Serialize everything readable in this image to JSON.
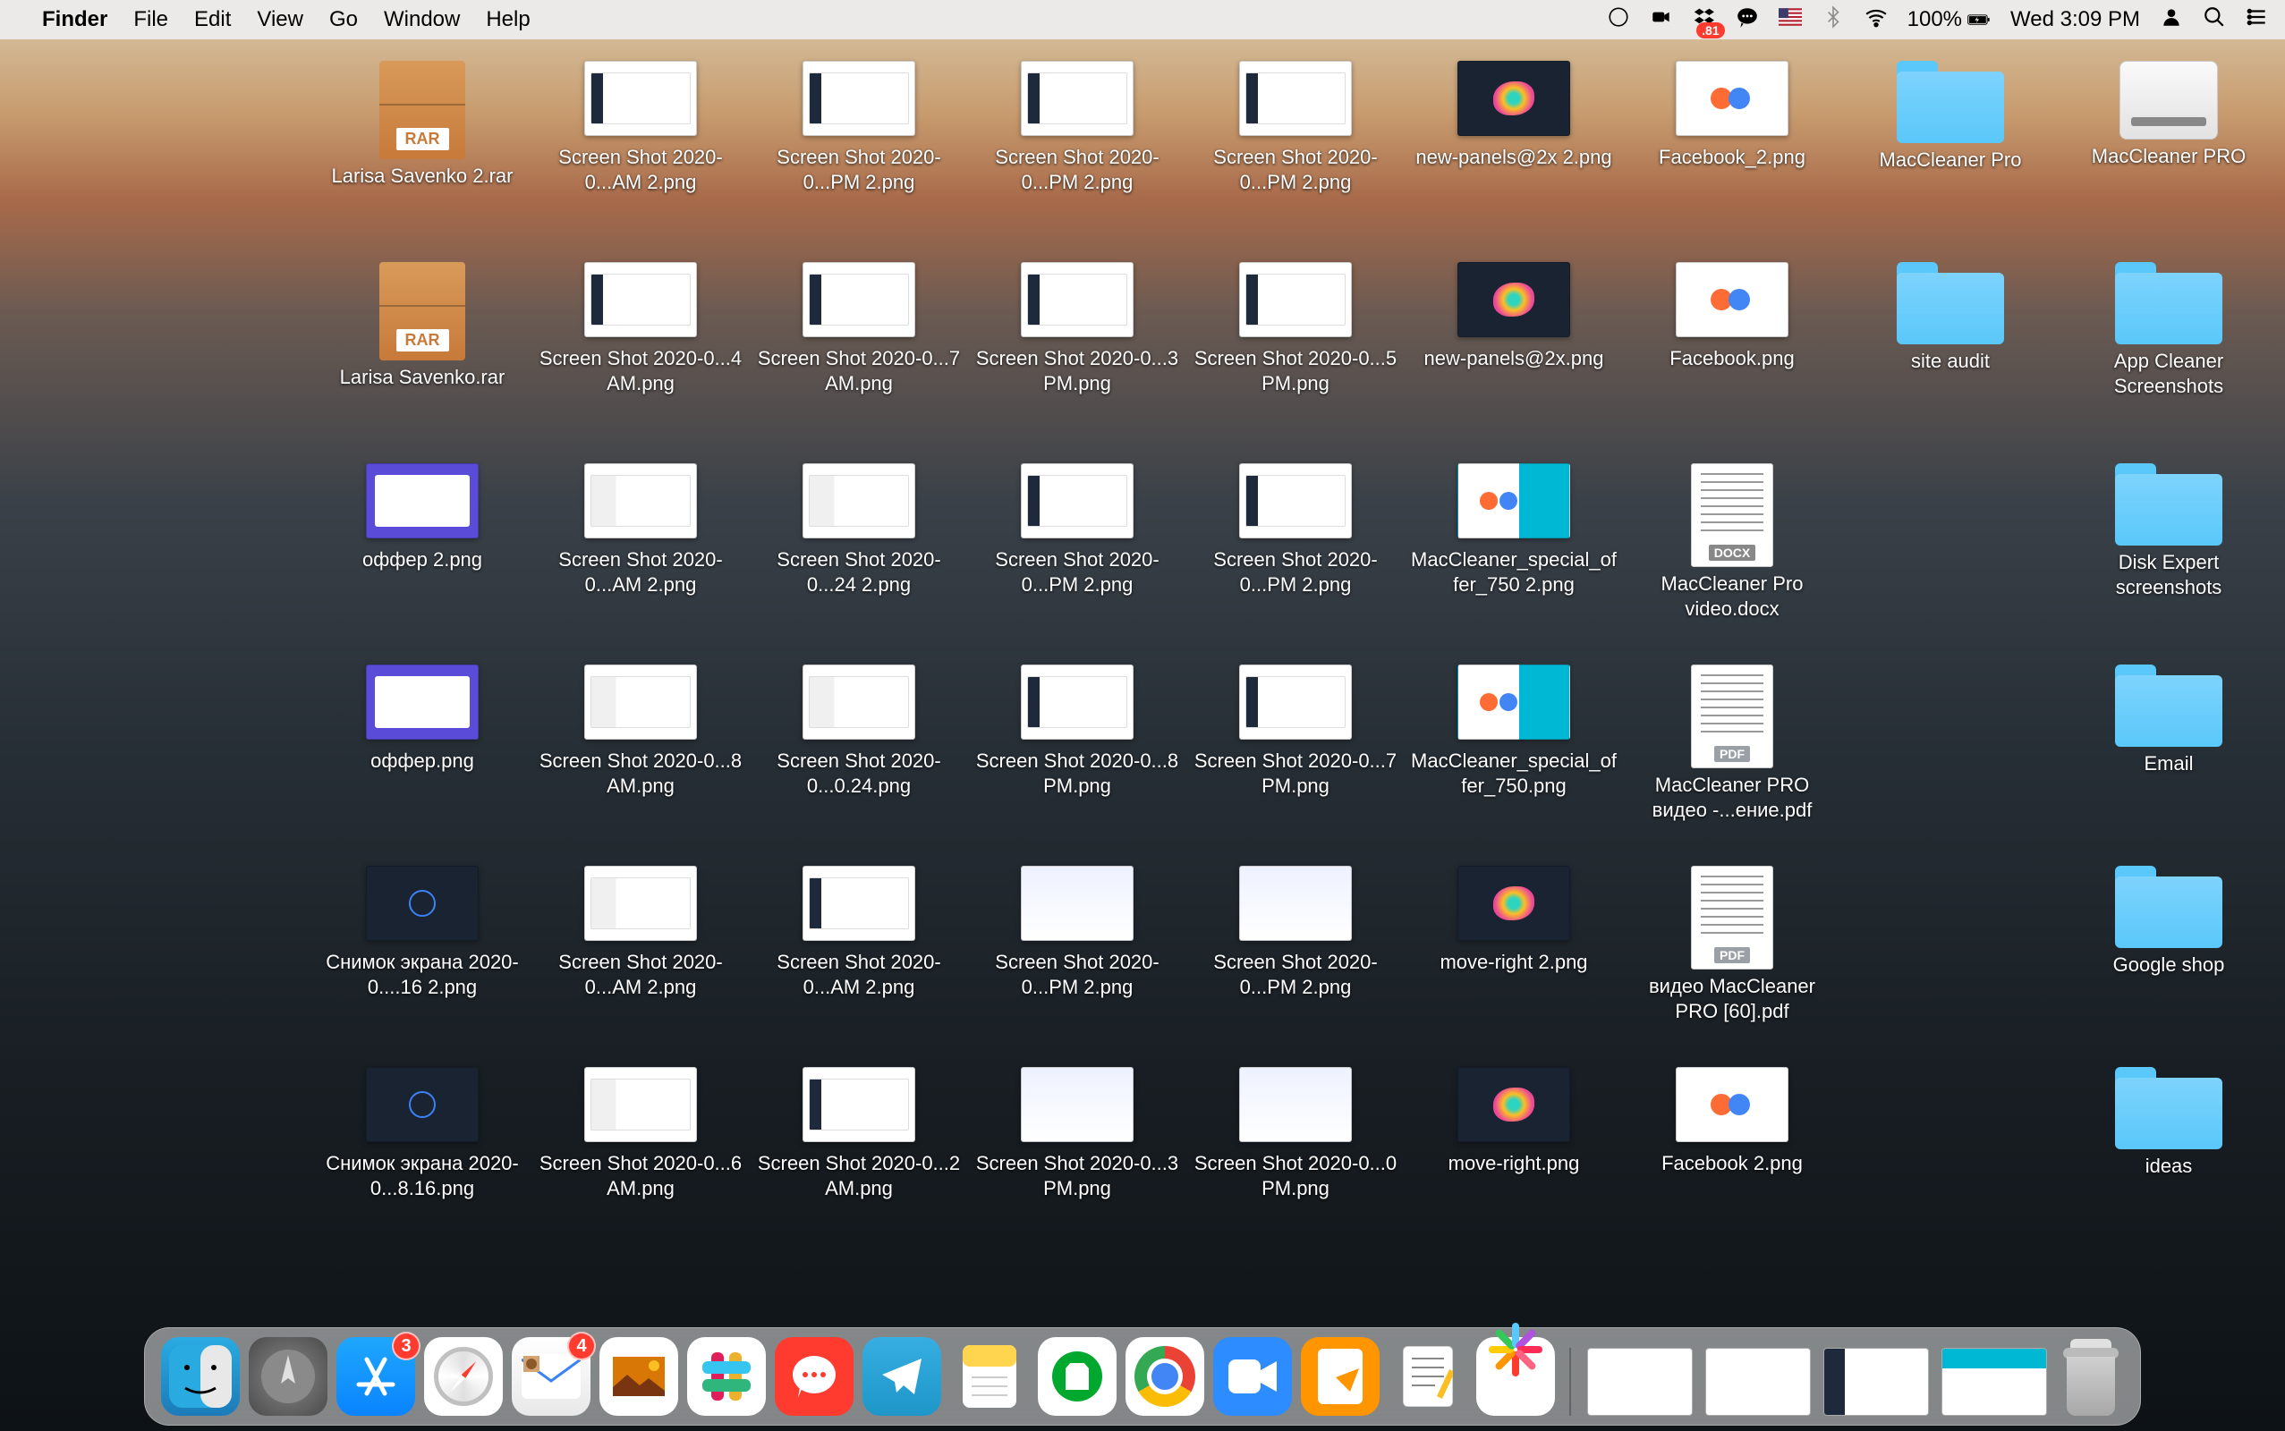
{
  "menubar": {
    "app": "Finder",
    "items": [
      "File",
      "Edit",
      "View",
      "Go",
      "Window",
      "Help"
    ],
    "dropbox_badge": ".81",
    "battery": "100%",
    "clock": "Wed 3:09 PM"
  },
  "desktop": {
    "rows": [
      [
        {
          "type": "rar",
          "label": "Larisa Savenko 2.rar"
        },
        {
          "type": "shot",
          "variant": "sb",
          "label": "Screen Shot 2020-0...AM 2.png"
        },
        {
          "type": "shot",
          "variant": "sb",
          "label": "Screen Shot 2020-0...PM 2.png"
        },
        {
          "type": "shot",
          "variant": "sb",
          "label": "Screen Shot 2020-0...PM 2.png"
        },
        {
          "type": "shot",
          "variant": "sb",
          "label": "Screen Shot 2020-0...PM 2.png"
        },
        {
          "type": "shot",
          "variant": "blob",
          "label": "new-panels@2x 2.png"
        },
        {
          "type": "shot",
          "variant": "fb",
          "label": "Facebook_2.png"
        },
        {
          "type": "folder",
          "label": "MacCleaner Pro"
        },
        {
          "type": "drive",
          "label": "MacCleaner PRO"
        }
      ],
      [
        {
          "type": "rar",
          "label": "Larisa Savenko.rar"
        },
        {
          "type": "shot",
          "variant": "sb",
          "label": "Screen Shot 2020-0...4 AM.png"
        },
        {
          "type": "shot",
          "variant": "sb",
          "label": "Screen Shot 2020-0...7 AM.png"
        },
        {
          "type": "shot",
          "variant": "sb",
          "label": "Screen Shot 2020-0...3 PM.png"
        },
        {
          "type": "shot",
          "variant": "sb",
          "label": "Screen Shot 2020-0...5 PM.png"
        },
        {
          "type": "shot",
          "variant": "blob",
          "label": "new-panels@2x.png"
        },
        {
          "type": "shot",
          "variant": "fb",
          "label": "Facebook.png"
        },
        {
          "type": "folder",
          "label": "site audit"
        },
        {
          "type": "folder",
          "label": "App Cleaner Screenshots"
        }
      ],
      [
        {
          "type": "shot",
          "variant": "purple",
          "label": "оффер 2.png"
        },
        {
          "type": "shot",
          "variant": "plain",
          "label": "Screen Shot 2020-0...AM 2.png"
        },
        {
          "type": "shot",
          "variant": "plain",
          "label": "Screen Shot 2020-0...24 2.png"
        },
        {
          "type": "shot",
          "variant": "sb",
          "label": "Screen Shot 2020-0...PM 2.png"
        },
        {
          "type": "shot",
          "variant": "sb",
          "label": "Screen Shot 2020-0...PM 2.png"
        },
        {
          "type": "shot",
          "variant": "mcl",
          "label": "MacCleaner_special_offer_750 2.png"
        },
        {
          "type": "doc",
          "docType": "DOCX",
          "label": "MacCleaner Pro video.docx"
        },
        {
          "type": "blank",
          "label": ""
        },
        {
          "type": "folder",
          "label": "Disk Expert screenshots"
        }
      ],
      [
        {
          "type": "shot",
          "variant": "purple",
          "label": "оффер.png"
        },
        {
          "type": "shot",
          "variant": "plain",
          "label": "Screen Shot 2020-0...8 AM.png"
        },
        {
          "type": "shot",
          "variant": "plain",
          "label": "Screen Shot 2020-0...0.24.png"
        },
        {
          "type": "shot",
          "variant": "sb",
          "label": "Screen Shot 2020-0...8 PM.png"
        },
        {
          "type": "shot",
          "variant": "sb",
          "label": "Screen Shot 2020-0...7 PM.png"
        },
        {
          "type": "shot",
          "variant": "mcl",
          "label": "MacCleaner_special_offer_750.png"
        },
        {
          "type": "doc",
          "docType": "PDF",
          "label": "MacCleaner PRO видео -...ение.pdf"
        },
        {
          "type": "blank",
          "label": ""
        },
        {
          "type": "folder",
          "label": "Email"
        }
      ],
      [
        {
          "type": "shot",
          "variant": "dark",
          "label": "Снимок экрана 2020-0....16 2.png"
        },
        {
          "type": "shot",
          "variant": "plain",
          "label": "Screen Shot 2020-0...AM 2.png"
        },
        {
          "type": "shot",
          "variant": "sb",
          "label": "Screen Shot 2020-0...AM 2.png"
        },
        {
          "type": "shot",
          "variant": "pale",
          "label": "Screen Shot 2020-0...PM 2.png"
        },
        {
          "type": "shot",
          "variant": "pale",
          "label": "Screen Shot 2020-0...PM 2.png"
        },
        {
          "type": "shot",
          "variant": "blob",
          "label": "move-right 2.png"
        },
        {
          "type": "doc",
          "docType": "PDF",
          "label": "видео MacCleaner PRO [60].pdf"
        },
        {
          "type": "blank",
          "label": ""
        },
        {
          "type": "folder",
          "label": "Google shop"
        }
      ],
      [
        {
          "type": "shot",
          "variant": "dark",
          "label": "Снимок экрана 2020-0...8.16.png"
        },
        {
          "type": "shot",
          "variant": "plain",
          "label": "Screen Shot 2020-0...6 AM.png"
        },
        {
          "type": "shot",
          "variant": "sb",
          "label": "Screen Shot 2020-0...2 AM.png"
        },
        {
          "type": "shot",
          "variant": "pale",
          "label": "Screen Shot 2020-0...3 PM.png"
        },
        {
          "type": "shot",
          "variant": "pale",
          "label": "Screen Shot 2020-0...0 PM.png"
        },
        {
          "type": "shot",
          "variant": "blob",
          "label": "move-right.png"
        },
        {
          "type": "shot",
          "variant": "fb",
          "label": "Facebook 2.png"
        },
        {
          "type": "blank",
          "label": ""
        },
        {
          "type": "folder",
          "label": "ideas"
        }
      ]
    ]
  },
  "dock": {
    "apps": [
      {
        "name": "finder",
        "cls": "di-finder",
        "badge": null
      },
      {
        "name": "launchpad",
        "cls": "di-launch",
        "badge": null
      },
      {
        "name": "app-store",
        "cls": "di-appstore",
        "badge": "3"
      },
      {
        "name": "safari",
        "cls": "di-safari",
        "badge": null
      },
      {
        "name": "mail",
        "cls": "di-mail",
        "badge": "4"
      },
      {
        "name": "photos",
        "cls": "di-photos",
        "badge": null
      },
      {
        "name": "slack",
        "cls": "di-slack",
        "badge": null
      },
      {
        "name": "messenger",
        "cls": "di-chat",
        "badge": null
      },
      {
        "name": "telegram",
        "cls": "di-tg",
        "badge": null
      },
      {
        "name": "notes",
        "cls": "di-notes",
        "badge": null
      },
      {
        "name": "evernote",
        "cls": "di-ever",
        "badge": null
      },
      {
        "name": "chrome",
        "cls": "di-chrome",
        "badge": null
      },
      {
        "name": "zoom",
        "cls": "di-zoom",
        "badge": null
      },
      {
        "name": "pages",
        "cls": "di-pages",
        "badge": null
      },
      {
        "name": "textedit",
        "cls": "di-text",
        "badge": null
      },
      {
        "name": "photo-app",
        "cls": "di-star",
        "badge": null
      }
    ],
    "minimized_count": 4
  }
}
